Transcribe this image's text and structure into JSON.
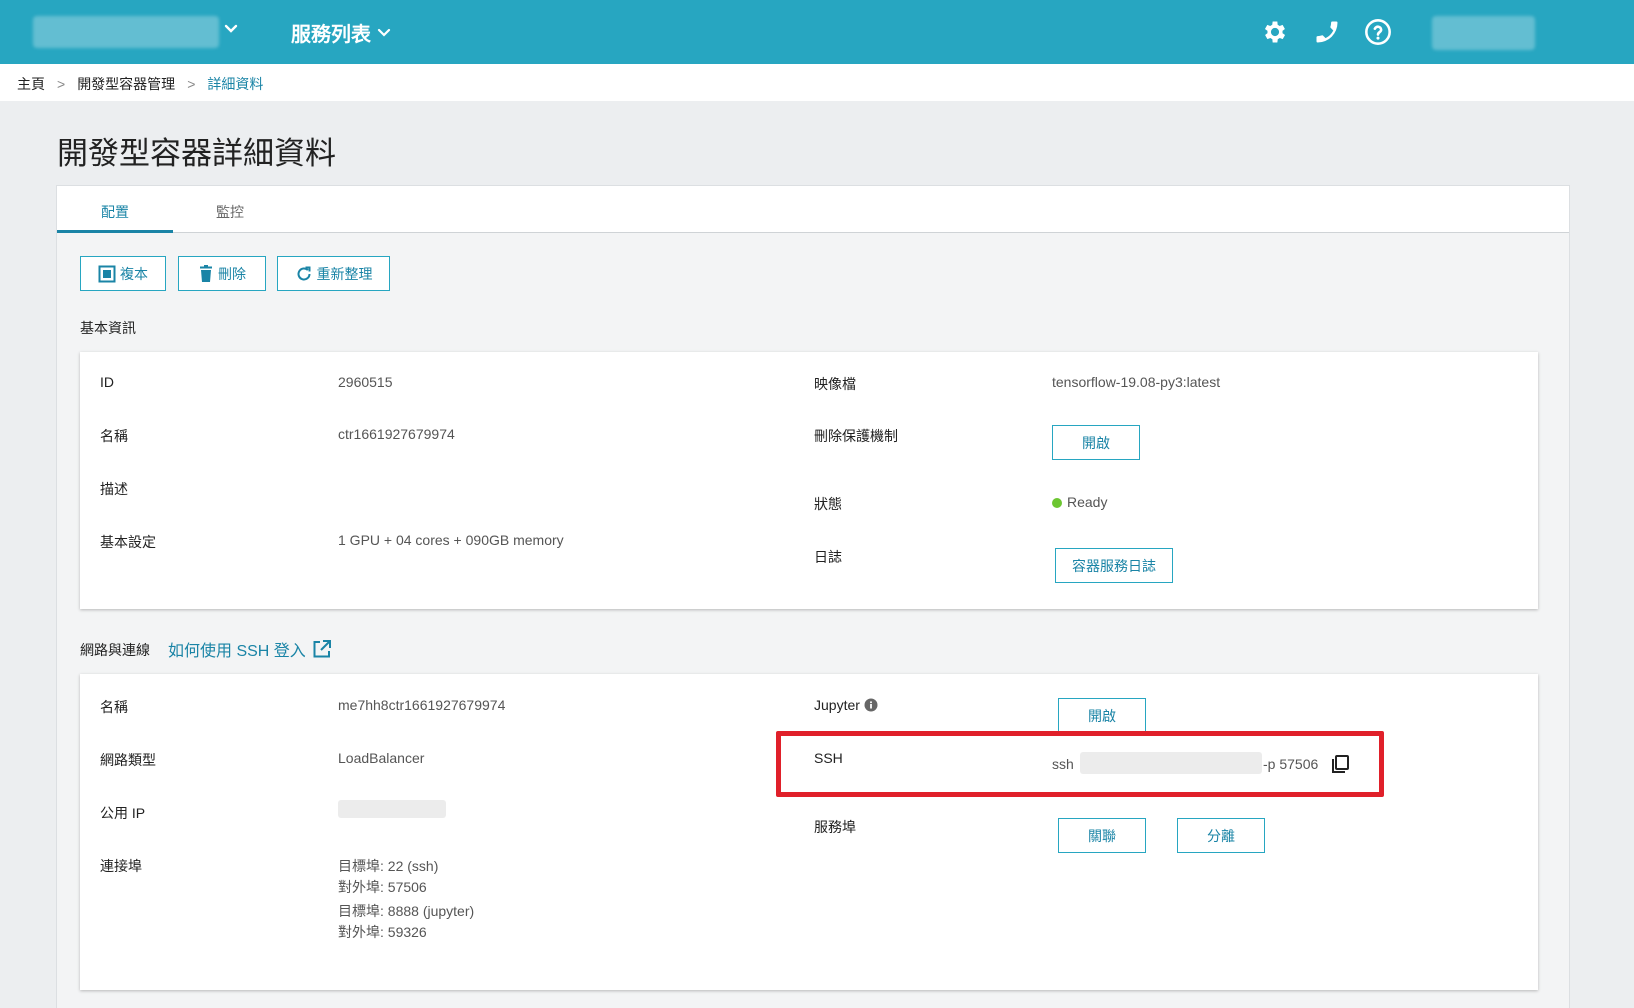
{
  "header": {
    "services_label": "服務列表"
  },
  "breadcrumb": {
    "home": "主頁",
    "section": "開發型容器管理",
    "current": "詳細資料",
    "separator": ">"
  },
  "page_title": "開發型容器詳細資料",
  "tabs": [
    {
      "label": "配置",
      "active": true
    },
    {
      "label": "監控",
      "active": false
    }
  ],
  "toolbar": {
    "copy_label": "複本",
    "delete_label": "刪除",
    "refresh_label": "重新整理"
  },
  "basic": {
    "section_label": "基本資訊",
    "id_label": "ID",
    "id_value": "2960515",
    "name_label": "名稱",
    "name_value": "ctr1661927679974",
    "desc_label": "描述",
    "config_label": "基本設定",
    "config_value": "1 GPU + 04 cores + 090GB memory",
    "image_label": "映像檔",
    "image_value": "tensorflow-19.08-py3:latest",
    "protect_label": "刪除保護機制",
    "protect_button": "開啟",
    "status_label": "狀態",
    "status_value": "Ready",
    "log_label": "日誌",
    "log_button": "容器服務日誌"
  },
  "network": {
    "section_label": "網路與連線",
    "help_link": "如何使用 SSH 登入",
    "name_label": "名稱",
    "name_value": "me7hh8ctr1661927679974",
    "type_label": "網路類型",
    "type_value": "LoadBalancer",
    "ip_label": "公用 IP",
    "ports_label": "連接埠",
    "ports": [
      {
        "target": "目標埠: 22 (ssh)",
        "external": "對外埠: 57506"
      },
      {
        "target": "目標埠: 8888 (jupyter)",
        "external": "對外埠: 59326"
      }
    ],
    "jupyter_label": "Jupyter",
    "jupyter_button": "開啟",
    "ssh_label": "SSH",
    "ssh_prefix": "ssh",
    "ssh_suffix": "-p 57506",
    "service_port_label": "服務埠",
    "associate_button": "關聯",
    "detach_button": "分離"
  },
  "colors": {
    "brand": "#27a6c1",
    "link": "#1a84a6",
    "highlight": "#e0202a",
    "ready": "#6cc631"
  }
}
